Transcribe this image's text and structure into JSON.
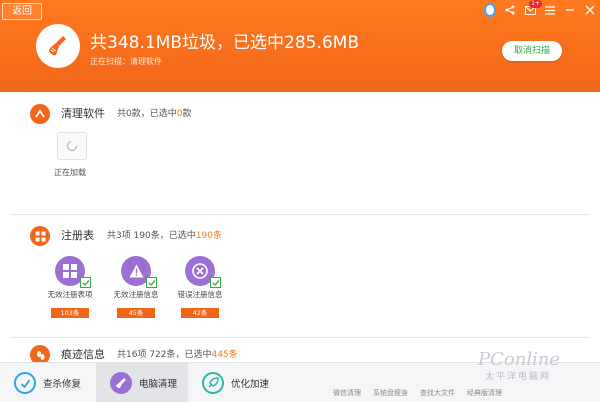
{
  "header": {
    "back_label": "返回",
    "title": "共348.1MB垃圾，已选中285.6MB",
    "status": "正在扫描：清理软件",
    "cancel_label": "取消扫描",
    "mail_badge": "1+",
    "accent_color": "#f2661a",
    "icons": [
      "user-avatar-icon",
      "share-icon",
      "mail-icon",
      "menu-icon",
      "minimize-icon",
      "close-icon"
    ]
  },
  "sections": {
    "software": {
      "title": "清理软件",
      "stat_prefix": "共0款，已选中",
      "stat_selected": "0",
      "stat_suffix": "款",
      "loading_label": "正在加载"
    },
    "registry": {
      "title": "注册表",
      "stat_prefix": "共3项 190条，已选中",
      "stat_selected": "190条",
      "items": [
        {
          "label": "无效注册表项",
          "count": "103条",
          "icon": "grid-icon"
        },
        {
          "label": "无效注册信息",
          "count": "45条",
          "icon": "warning-icon"
        },
        {
          "label": "错误注册信息",
          "count": "42条",
          "icon": "error-x-icon"
        }
      ]
    },
    "traces": {
      "title": "痕迹信息",
      "stat_prefix": "共16项 722条，已选中",
      "stat_selected": "445条"
    }
  },
  "bottom_tabs": [
    {
      "label": "查杀修复",
      "icon": "shield-icon",
      "color": "#2aa5e6"
    },
    {
      "label": "电脑清理",
      "icon": "broom-icon",
      "color": "#9b6fd4"
    },
    {
      "label": "优化加速",
      "icon": "rocket-icon",
      "color": "#2fb5a3"
    }
  ],
  "tool_links": [
    "微信清理",
    "系统盘瘦身",
    "查找大文件",
    "经典版清理"
  ],
  "watermark": {
    "brand": "PConline",
    "subtitle": "太平洋电脑网"
  }
}
